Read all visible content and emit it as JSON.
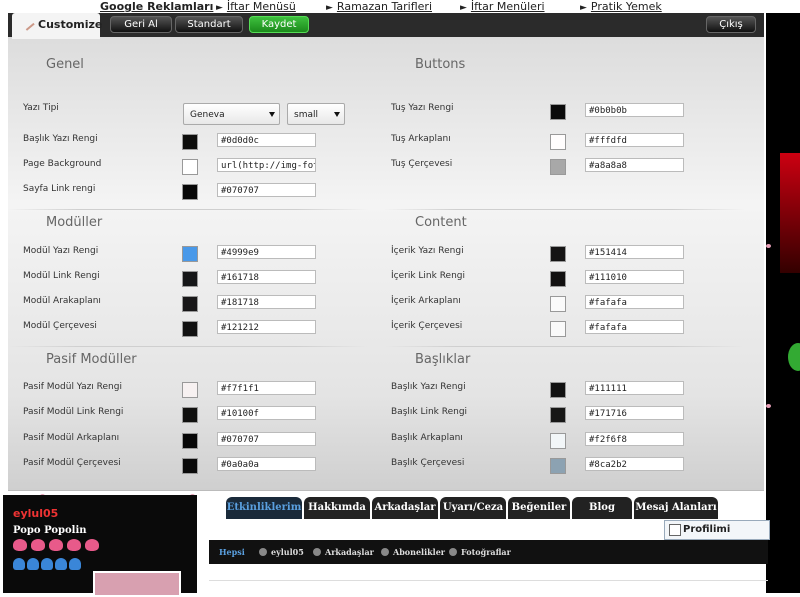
{
  "top_links": {
    "google": "Google Reklamları",
    "items": [
      "İftar Menüsü",
      "Ramazan Tarifleri",
      "İftar Menüleri",
      "Pratik Yemek"
    ]
  },
  "toolbar": {
    "customize": "Customize",
    "undo": "Geri Al",
    "standard": "Standart",
    "save": "Kaydet",
    "exit": "Çıkış"
  },
  "sections": {
    "genel": "Genel",
    "buttons": "Buttons",
    "moduller": "Modüller",
    "content": "Content",
    "pasif": "Pasif Modüller",
    "basliklar": "Başlıklar"
  },
  "genel": {
    "font_label": "Yazı Tipi",
    "font_value": "Geneva",
    "size_value": "small",
    "rows": [
      {
        "label": "Başlık Yazı Rengi",
        "value": "#0d0d0c",
        "color": "#0d0d0c"
      },
      {
        "label": "Page Background",
        "value": "url(http://img-fotki.ya",
        "color": "#ffffff"
      },
      {
        "label": "Sayfa Link rengi",
        "value": "#070707",
        "color": "#070707"
      }
    ]
  },
  "buttons": {
    "rows": [
      {
        "label": "Tuş Yazı Rengi",
        "value": "#0b0b0b",
        "color": "#0b0b0b"
      },
      {
        "label": "Tuş Arkaplanı",
        "value": "#fffdfd",
        "color": "#fffdfd"
      },
      {
        "label": "Tuş Çerçevesi",
        "value": "#a8a8a8",
        "color": "#a8a8a8"
      }
    ]
  },
  "moduller": {
    "rows": [
      {
        "label": "Modül Yazı Rengi",
        "value": "#4999e9",
        "color": "#4999e9"
      },
      {
        "label": "Modül Link Rengi",
        "value": "#161718",
        "color": "#161718"
      },
      {
        "label": "Modül Arakaplanı",
        "value": "#181718",
        "color": "#181718"
      },
      {
        "label": "Modül Çerçevesi",
        "value": "#121212",
        "color": "#121212"
      }
    ]
  },
  "content": {
    "rows": [
      {
        "label": "İçerik Yazı Rengi",
        "value": "#151414",
        "color": "#151414"
      },
      {
        "label": "İçerik Link Rengi",
        "value": "#111010",
        "color": "#111010"
      },
      {
        "label": "İçerik Arkaplanı",
        "value": "#fafafa",
        "color": "#fafafa"
      },
      {
        "label": "İçerik Çerçevesi",
        "value": "#fafafa",
        "color": "#fafafa"
      }
    ]
  },
  "pasif": {
    "rows": [
      {
        "label": "Pasif Modül Yazı Rengi",
        "value": "#f7f1f1",
        "color": "#f7f1f1"
      },
      {
        "label": "Pasif Modül Link Rengi",
        "value": "#10100f",
        "color": "#10100f"
      },
      {
        "label": "Pasif Modül Arkaplanı",
        "value": "#070707",
        "color": "#070707"
      },
      {
        "label": "Pasif Modül Çerçevesi",
        "value": "#0a0a0a",
        "color": "#0a0a0a"
      }
    ]
  },
  "basliklar": {
    "rows": [
      {
        "label": "Başlık Yazı Rengi",
        "value": "#111111",
        "color": "#111111"
      },
      {
        "label": "Başlık Link Rengi",
        "value": "#171716",
        "color": "#171716"
      },
      {
        "label": "Başlık Arkaplanı",
        "value": "#f2f6f8",
        "color": "#f2f6f8"
      },
      {
        "label": "Başlık Çerçevesi",
        "value": "#8ca2b2",
        "color": "#8ca2b2"
      }
    ]
  },
  "profile": {
    "username": "eylul05",
    "subtitle": "Popo Popolin"
  },
  "profile_tabs": [
    "Etkinliklerim",
    "Hakkımda",
    "Arkadaşlar",
    "Uyarı/Ceza",
    "Beğeniler",
    "Blog",
    "Mesaj Alanları"
  ],
  "edit_profile": "Profilimi Düzenle",
  "sub_tabs": [
    "Hepsi",
    "eylul05",
    "Arkadaşlar",
    "Abonelikler",
    "Fotoğraflar"
  ]
}
